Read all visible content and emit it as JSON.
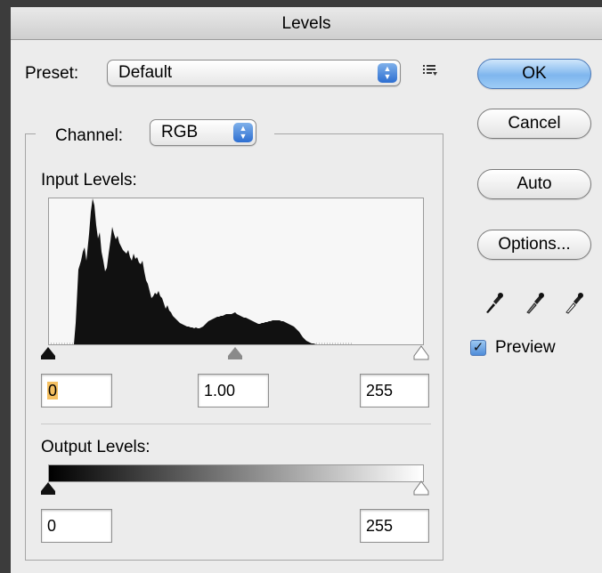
{
  "window": {
    "title": "Levels"
  },
  "preset": {
    "label": "Preset:",
    "value": "Default"
  },
  "channel": {
    "label": "Channel:",
    "value": "RGB"
  },
  "input_levels": {
    "label": "Input Levels:",
    "black": "0",
    "gamma": "1.00",
    "white": "255"
  },
  "output_levels": {
    "label": "Output Levels:",
    "black": "0",
    "white": "255"
  },
  "buttons": {
    "ok": "OK",
    "cancel": "Cancel",
    "auto": "Auto",
    "options": "Options..."
  },
  "preview": {
    "label": "Preview",
    "checked": true
  },
  "icons": {
    "preset_menu": "list-menu-icon",
    "black_eyedropper": "eyedropper-black-icon",
    "gray_eyedropper": "eyedropper-gray-icon",
    "white_eyedropper": "eyedropper-white-icon"
  }
}
